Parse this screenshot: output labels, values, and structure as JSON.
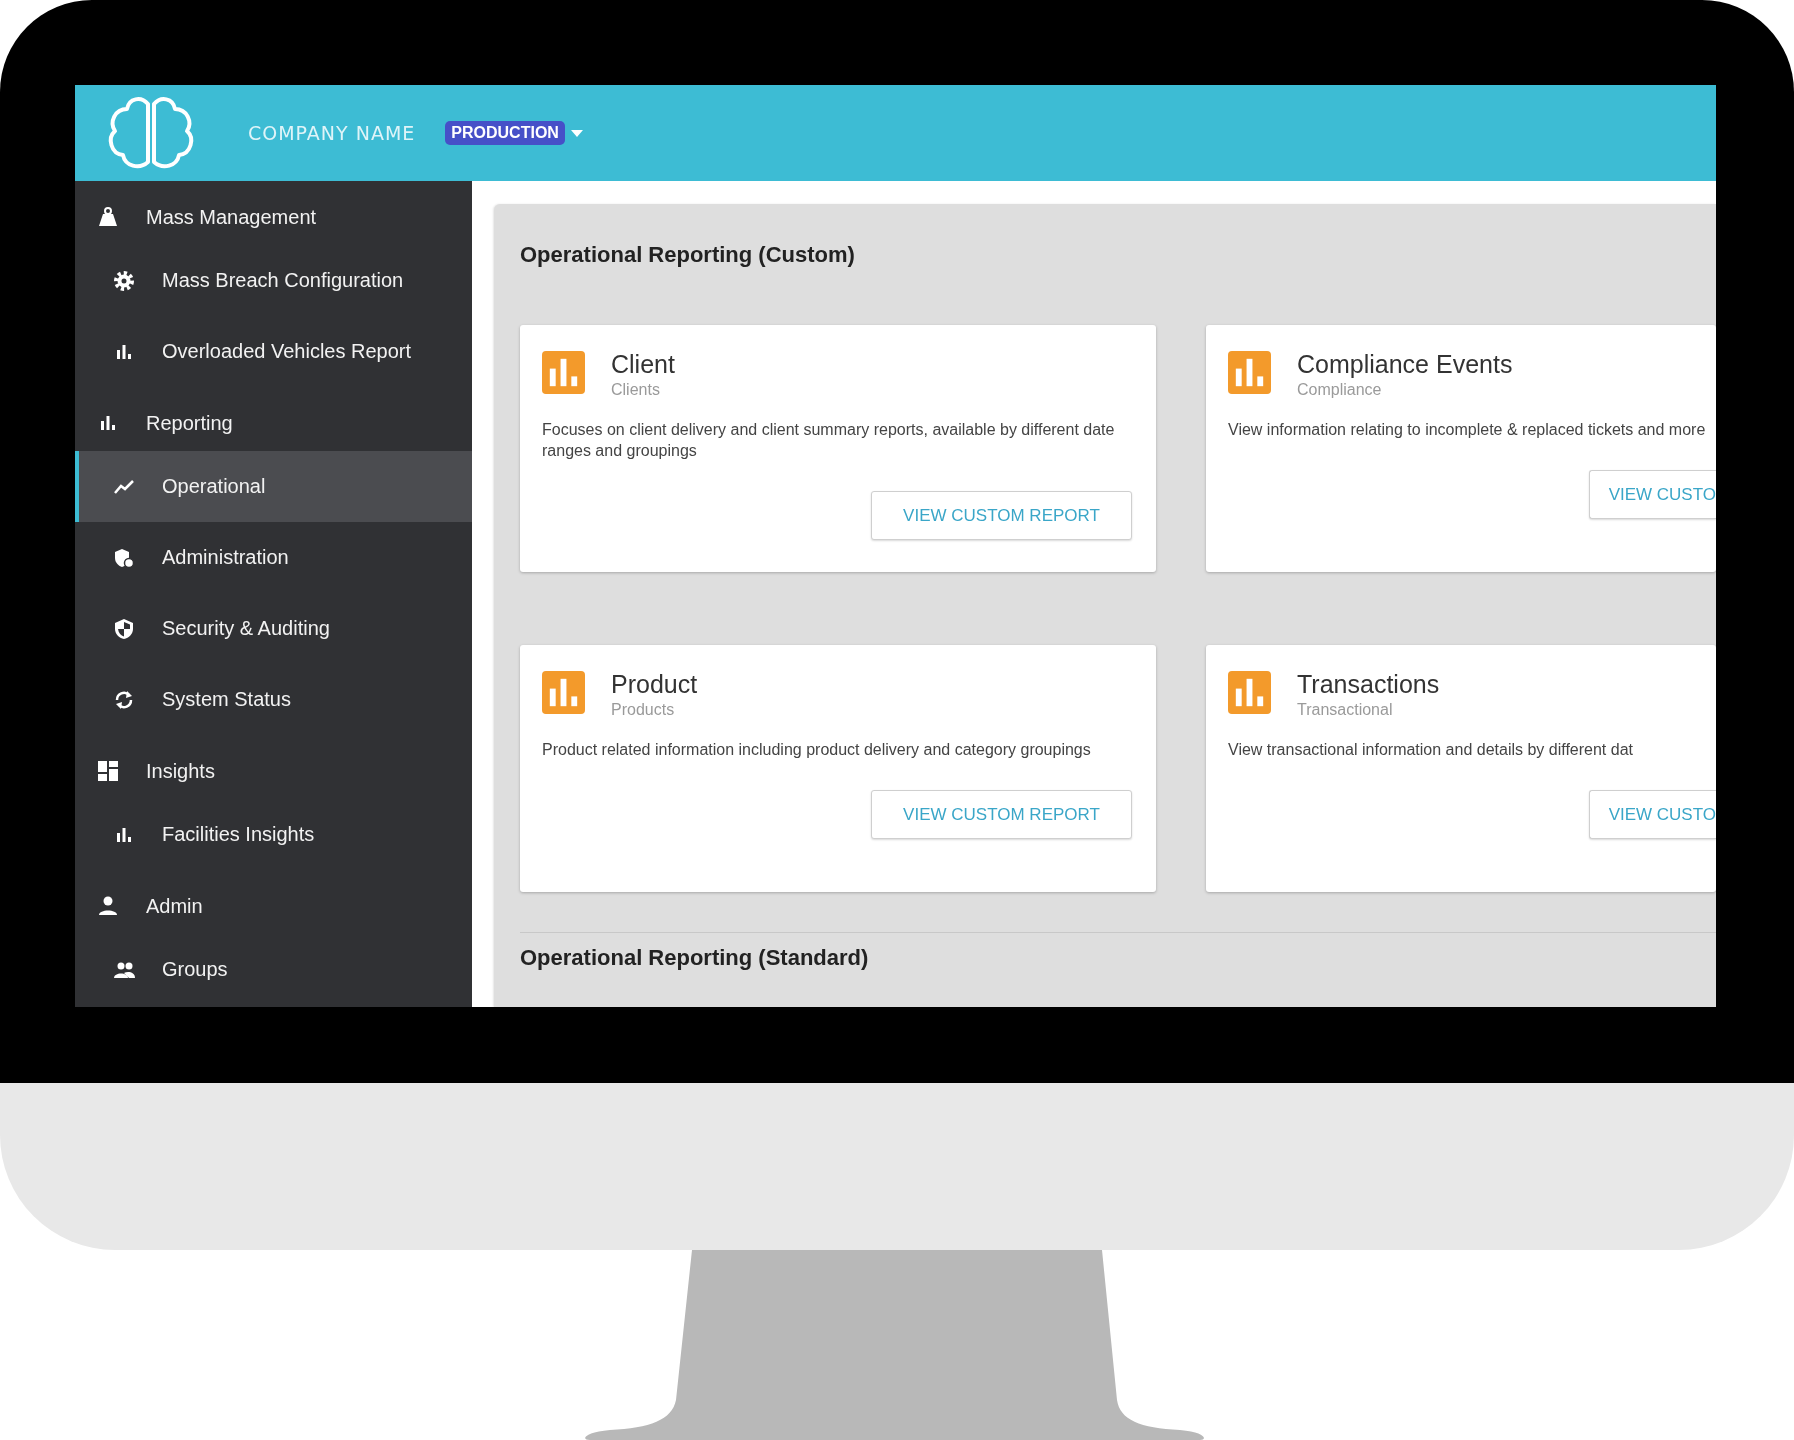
{
  "header": {
    "company_name": "COMPANY NAME",
    "environment": {
      "label": "PRODUCTION"
    }
  },
  "sidebar": {
    "items": [
      {
        "label": "Mass Management",
        "selected": false,
        "children": [
          {
            "label": "Mass Breach Configuration",
            "selected": false
          },
          {
            "label": "Overloaded Vehicles Report",
            "selected": false
          }
        ]
      },
      {
        "label": "Reporting",
        "selected": false,
        "children": [
          {
            "label": "Operational",
            "selected": true
          },
          {
            "label": "Administration",
            "selected": false
          },
          {
            "label": "Security & Auditing",
            "selected": false
          },
          {
            "label": "System Status",
            "selected": false
          }
        ]
      },
      {
        "label": "Insights",
        "selected": false,
        "children": [
          {
            "label": "Facilities Insights",
            "selected": false
          }
        ]
      },
      {
        "label": "Admin",
        "selected": false,
        "children": [
          {
            "label": "Groups",
            "selected": false
          }
        ]
      }
    ]
  },
  "main": {
    "sections": [
      {
        "title": "Operational Reporting (Custom)",
        "cards": [
          {
            "title": "Client",
            "subtitle": "Clients",
            "description": "Focuses on client delivery and client summary reports, available by different date ranges and groupings",
            "button": "VIEW CUSTOM REPORT"
          },
          {
            "title": "Compliance Events",
            "subtitle": "Compliance",
            "description": "View information relating to incomplete & replaced tickets and more",
            "button": "VIEW CUSTO"
          },
          {
            "title": "Product",
            "subtitle": "Products",
            "description": "Product related information including product delivery and category groupings",
            "button": "VIEW CUSTOM REPORT"
          },
          {
            "title": "Transactions",
            "subtitle": "Transactional",
            "description": "View transactional information and details by different dat",
            "button": "VIEW CUSTO"
          }
        ]
      },
      {
        "title": "Operational Reporting (Standard)"
      }
    ]
  }
}
